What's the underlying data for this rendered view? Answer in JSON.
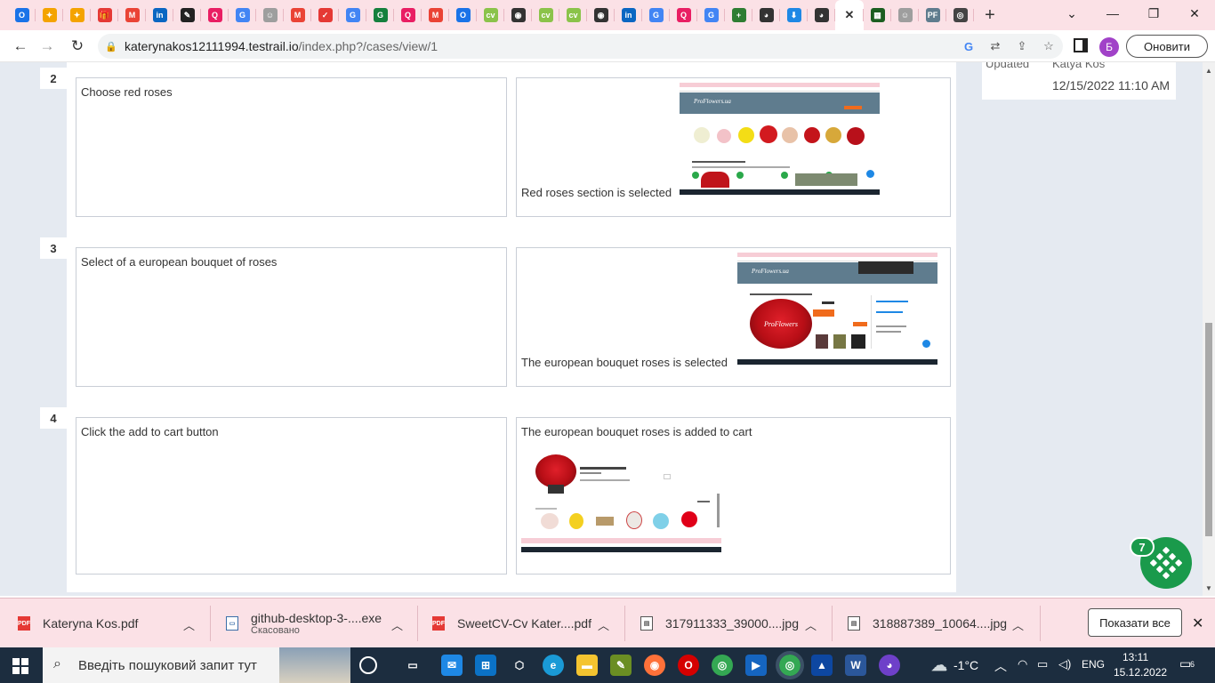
{
  "browser": {
    "tabs": [
      {
        "icon": "opera-icon",
        "color": "#1a73e8",
        "glyph": "O"
      },
      {
        "icon": "crowd-icon",
        "color": "#f4a300",
        "glyph": "✦"
      },
      {
        "icon": "crowd-icon",
        "color": "#f4a300",
        "glyph": "✦"
      },
      {
        "icon": "gift-icon",
        "color": "#e53935",
        "glyph": "🎁"
      },
      {
        "icon": "gmail-icon",
        "color": "#ea4335",
        "glyph": "M"
      },
      {
        "icon": "linkedin-icon",
        "color": "#0a66c2",
        "glyph": "in"
      },
      {
        "icon": "pen-icon",
        "color": "#222222",
        "glyph": "✎"
      },
      {
        "icon": "chat-icon",
        "color": "#e91e63",
        "glyph": "Q"
      },
      {
        "icon": "google-icon",
        "color": "#4285f4",
        "glyph": "G"
      },
      {
        "icon": "ghost-icon",
        "color": "#9e9e9e",
        "glyph": "☺"
      },
      {
        "icon": "gmail-icon",
        "color": "#ea4335",
        "glyph": "M"
      },
      {
        "icon": "pulse-icon",
        "color": "#e53935",
        "glyph": "✓"
      },
      {
        "icon": "google-icon",
        "color": "#4285f4",
        "glyph": "G"
      },
      {
        "icon": "grammarly-icon",
        "color": "#15803d",
        "glyph": "G"
      },
      {
        "icon": "chat-icon",
        "color": "#e91e63",
        "glyph": "Q"
      },
      {
        "icon": "gmail-icon",
        "color": "#ea4335",
        "glyph": "M"
      },
      {
        "icon": "opera-icon",
        "color": "#1a73e8",
        "glyph": "O"
      },
      {
        "icon": "cv-icon",
        "color": "#8bc34a",
        "glyph": "cv"
      },
      {
        "icon": "globe-icon",
        "color": "#333333",
        "glyph": "◉"
      },
      {
        "icon": "cv-icon",
        "color": "#8bc34a",
        "glyph": "cv"
      },
      {
        "icon": "cv-icon",
        "color": "#8bc34a",
        "glyph": "cv"
      },
      {
        "icon": "globe-icon",
        "color": "#333333",
        "glyph": "◉"
      },
      {
        "icon": "linkedin-icon",
        "color": "#0a66c2",
        "glyph": "in"
      },
      {
        "icon": "google-icon",
        "color": "#4285f4",
        "glyph": "G"
      },
      {
        "icon": "chat-icon",
        "color": "#e91e63",
        "glyph": "Q"
      },
      {
        "icon": "google-icon",
        "color": "#4285f4",
        "glyph": "G"
      },
      {
        "icon": "plus-icon",
        "color": "#2e7d32",
        "glyph": "+"
      },
      {
        "icon": "github-icon",
        "color": "#333333",
        "glyph": "◕"
      },
      {
        "icon": "download-icon",
        "color": "#1e88e5",
        "glyph": "⬇"
      },
      {
        "icon": "github-icon",
        "color": "#333333",
        "glyph": "◕"
      },
      {
        "icon": "close-icon",
        "color": "#333333",
        "glyph": "✕",
        "active": true
      },
      {
        "icon": "testrail-icon",
        "color": "#1b5e20",
        "glyph": "▦"
      },
      {
        "icon": "ghost-icon",
        "color": "#9e9e9e",
        "glyph": "☺"
      },
      {
        "icon": "pf-icon",
        "color": "#5f7c8e",
        "glyph": "PF"
      },
      {
        "icon": "circle-icon",
        "color": "#444444",
        "glyph": "◎"
      }
    ],
    "url_host": "katerynakos12111994.testrail.io",
    "url_path": "/index.php?/cases/view/1",
    "profile_initial": "Б",
    "update_label": "Оновити"
  },
  "sidebar": {
    "top_label_cut": "Updated",
    "top_value_cut": "Katya Kos",
    "date": "12/15/2022 11:10 AM"
  },
  "steps": [
    {
      "number": "2",
      "step": "Choose red roses",
      "expected": "Red roses section is selected"
    },
    {
      "number": "3",
      "step": "Select of a european bouquet of roses",
      "expected": "The european bouquet roses is selected"
    },
    {
      "number": "4",
      "step": "Click the add to cart button",
      "expected": "The european bouquet roses is added to cart"
    }
  ],
  "fab": {
    "badge": "7"
  },
  "downloads": [
    {
      "name": "Kateryna Kos.pdf",
      "status": "",
      "type": "pdf"
    },
    {
      "name": "github-desktop-3-....exe",
      "status": "Скасовано",
      "type": "exe"
    },
    {
      "name": "SweetCV-Cv Kater....pdf",
      "status": "",
      "type": "pdf"
    },
    {
      "name": "317911333_39000....jpg",
      "status": "",
      "type": "jpg"
    },
    {
      "name": "318887389_10064....jpg",
      "status": "",
      "type": "jpg"
    }
  ],
  "shelf": {
    "show_all": "Показати все"
  },
  "taskbar": {
    "search_placeholder": "Введіть пошуковий запит тут",
    "weather": "-1°C",
    "lang": "ENG",
    "time": "13:11",
    "date": "15.12.2022",
    "notifications": "6"
  },
  "colors": {
    "accent": "#1a9a4b",
    "tabstrip": "#fbe1e6",
    "page_bg": "#e5eaf1"
  }
}
